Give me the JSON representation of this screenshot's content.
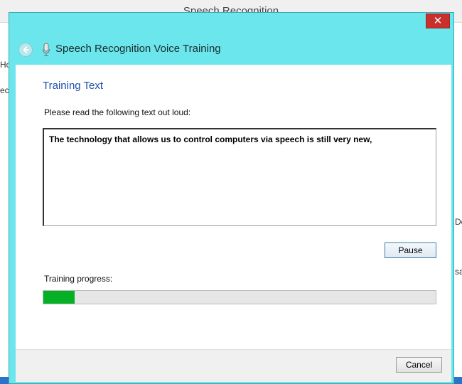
{
  "background_window": {
    "title": "Speech Recognition",
    "fragments": [
      "Ho",
      "ech",
      "De",
      "sa"
    ]
  },
  "dialog": {
    "close_glyph": "✕",
    "title": "Speech Recognition Voice Training",
    "heading": "Training Text",
    "instruction": "Please read the following text out loud:",
    "training_text": "The technology that allows us to control computers via speech is still very new,",
    "pause_label": "Pause",
    "progress_label": "Training progress:",
    "progress_fraction": 0.08,
    "cancel_label": "Cancel"
  },
  "colors": {
    "dialog_frame": "#6ae6ec",
    "close_button": "#c9302c",
    "heading": "#1f4fa8",
    "progress_fill": "#06b025"
  },
  "icons": {
    "back": "back-arrow-icon",
    "microphone": "microphone-icon",
    "close": "close-icon"
  }
}
